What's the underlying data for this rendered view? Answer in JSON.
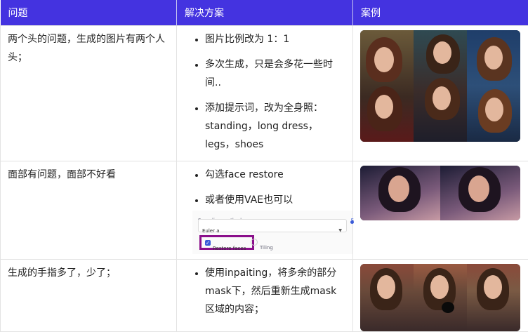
{
  "headers": [
    "问题",
    "解决方案",
    "案例"
  ],
  "rows": [
    {
      "problem": "两个头的问题，生成的图片有两个人头；",
      "solutions": [
        "图片比例改为 1：1",
        "多次生成，只是会多花一些时间..",
        "添加提示词，改为全身照：standing，long dress，legs，shoes"
      ],
      "example_image": "portrait-grid-image"
    },
    {
      "problem": "面部有问题，面部不好看",
      "solutions": [
        "勾选face restore",
        "或者使用VAE也可以"
      ],
      "settings_shot": {
        "sampling_label": "Sampling method",
        "sampler_value": "Euler a",
        "restore_faces": "Restore faces",
        "tiling": "Tiling",
        "side_letter": "S"
      },
      "example_image": "face-restore-image"
    },
    {
      "problem": "生成的手指多了，少了；",
      "solutions": [
        "使用inpaiting，将多余的部分mask下，然后重新生成mask区域的内容；"
      ],
      "example_image": "inpainting-hands-image"
    }
  ],
  "colors": {
    "header_bg": "#4433e0",
    "highlight_border": "#8b0f8b"
  }
}
